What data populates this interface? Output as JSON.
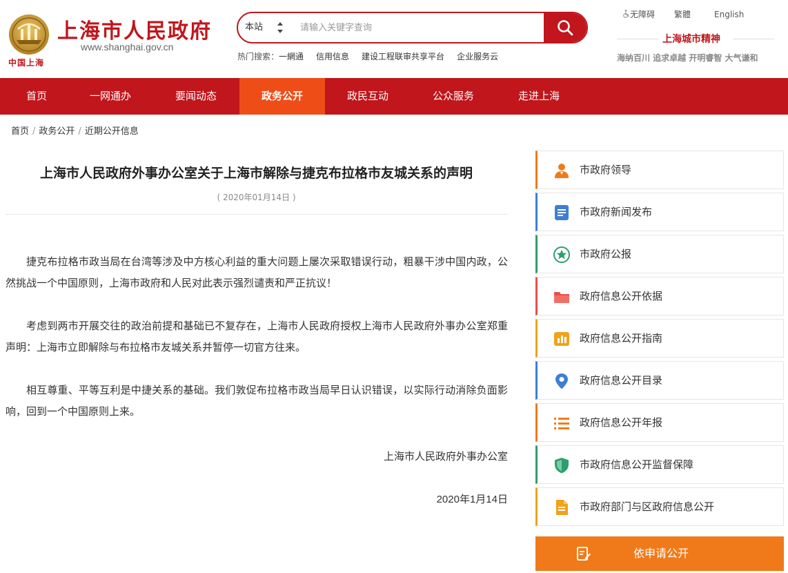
{
  "header": {
    "emblem_caption": "中国上海",
    "site_title": "上海市人民政府",
    "site_url": "www.shanghai.gov.cn",
    "search": {
      "scope": "本站",
      "placeholder": "请输入关键字查询",
      "value": ""
    },
    "hot_label": "热门搜索：",
    "hot_links": [
      "一網通",
      "信用信息",
      "建设工程联审共享平台",
      "企业服务云"
    ],
    "accessibility": "无障碍",
    "traditional": "繁體",
    "english": "English",
    "spirit_title": "上海城市精神",
    "spirit_motto": "海纳百川 追求卓越 开明睿智 大气谦和"
  },
  "nav": {
    "items": [
      "首页",
      "一网通办",
      "要闻动态",
      "政务公开",
      "政民互动",
      "公众服务",
      "走进上海"
    ],
    "active": "政务公开"
  },
  "breadcrumb": [
    "首页",
    "政务公开",
    "近期公开信息"
  ],
  "article": {
    "title": "上海市人民政府外事办公室关于上海市解除与捷克布拉格市友城关系的声明",
    "date": "( 2020年01月14日 )",
    "paragraphs": [
      "捷克布拉格市政当局在台湾等涉及中方核心利益的重大问题上屡次采取错误行动，粗暴干涉中国内政，公然挑战一个中国原则，上海市政府和人民对此表示强烈谴责和严正抗议！",
      "考虑到两市开展交往的政治前提和基础已不复存在，上海市人民政府授权上海市人民政府外事办公室郑重声明：上海市立即解除与布拉格市友城关系并暂停一切官方往来。",
      "相互尊重、平等互利是中捷关系的基础。我们敦促布拉格市政当局早日认识错误，以实际行动消除负面影响，回到一个中国原则上来。"
    ],
    "signature": "上海市人民政府外事办公室",
    "sign_date": "2020年1月14日"
  },
  "sidebar": {
    "items": [
      {
        "label": "市政府领导",
        "icon": "leader-person-icon",
        "color": "#f07a1a"
      },
      {
        "label": "市政府新闻发布",
        "icon": "news-document-icon",
        "color": "#3d7fd6"
      },
      {
        "label": "市政府公报",
        "icon": "gazette-star-icon",
        "color": "#2e9e6e"
      },
      {
        "label": "政府信息公开依据",
        "icon": "folder-icon",
        "color": "#e8504a"
      },
      {
        "label": "政府信息公开指南",
        "icon": "guide-chart-icon",
        "color": "#f0a21a"
      },
      {
        "label": "政府信息公开目录",
        "icon": "location-pin-icon",
        "color": "#3d7fd6"
      },
      {
        "label": "政府信息公开年报",
        "icon": "list-icon",
        "color": "#f07a1a"
      },
      {
        "label": "市政府信息公开监督保障",
        "icon": "shield-icon",
        "color": "#2e9e6e"
      },
      {
        "label": "市政府部门与区政府信息公开",
        "icon": "file-icon",
        "color": "#f0a21a"
      }
    ],
    "apply_label": "依申请公开"
  },
  "colors": {
    "brand_red": "#c0161c",
    "nav_active": "#ef4d17",
    "apply_orange": "#f07a1a"
  }
}
